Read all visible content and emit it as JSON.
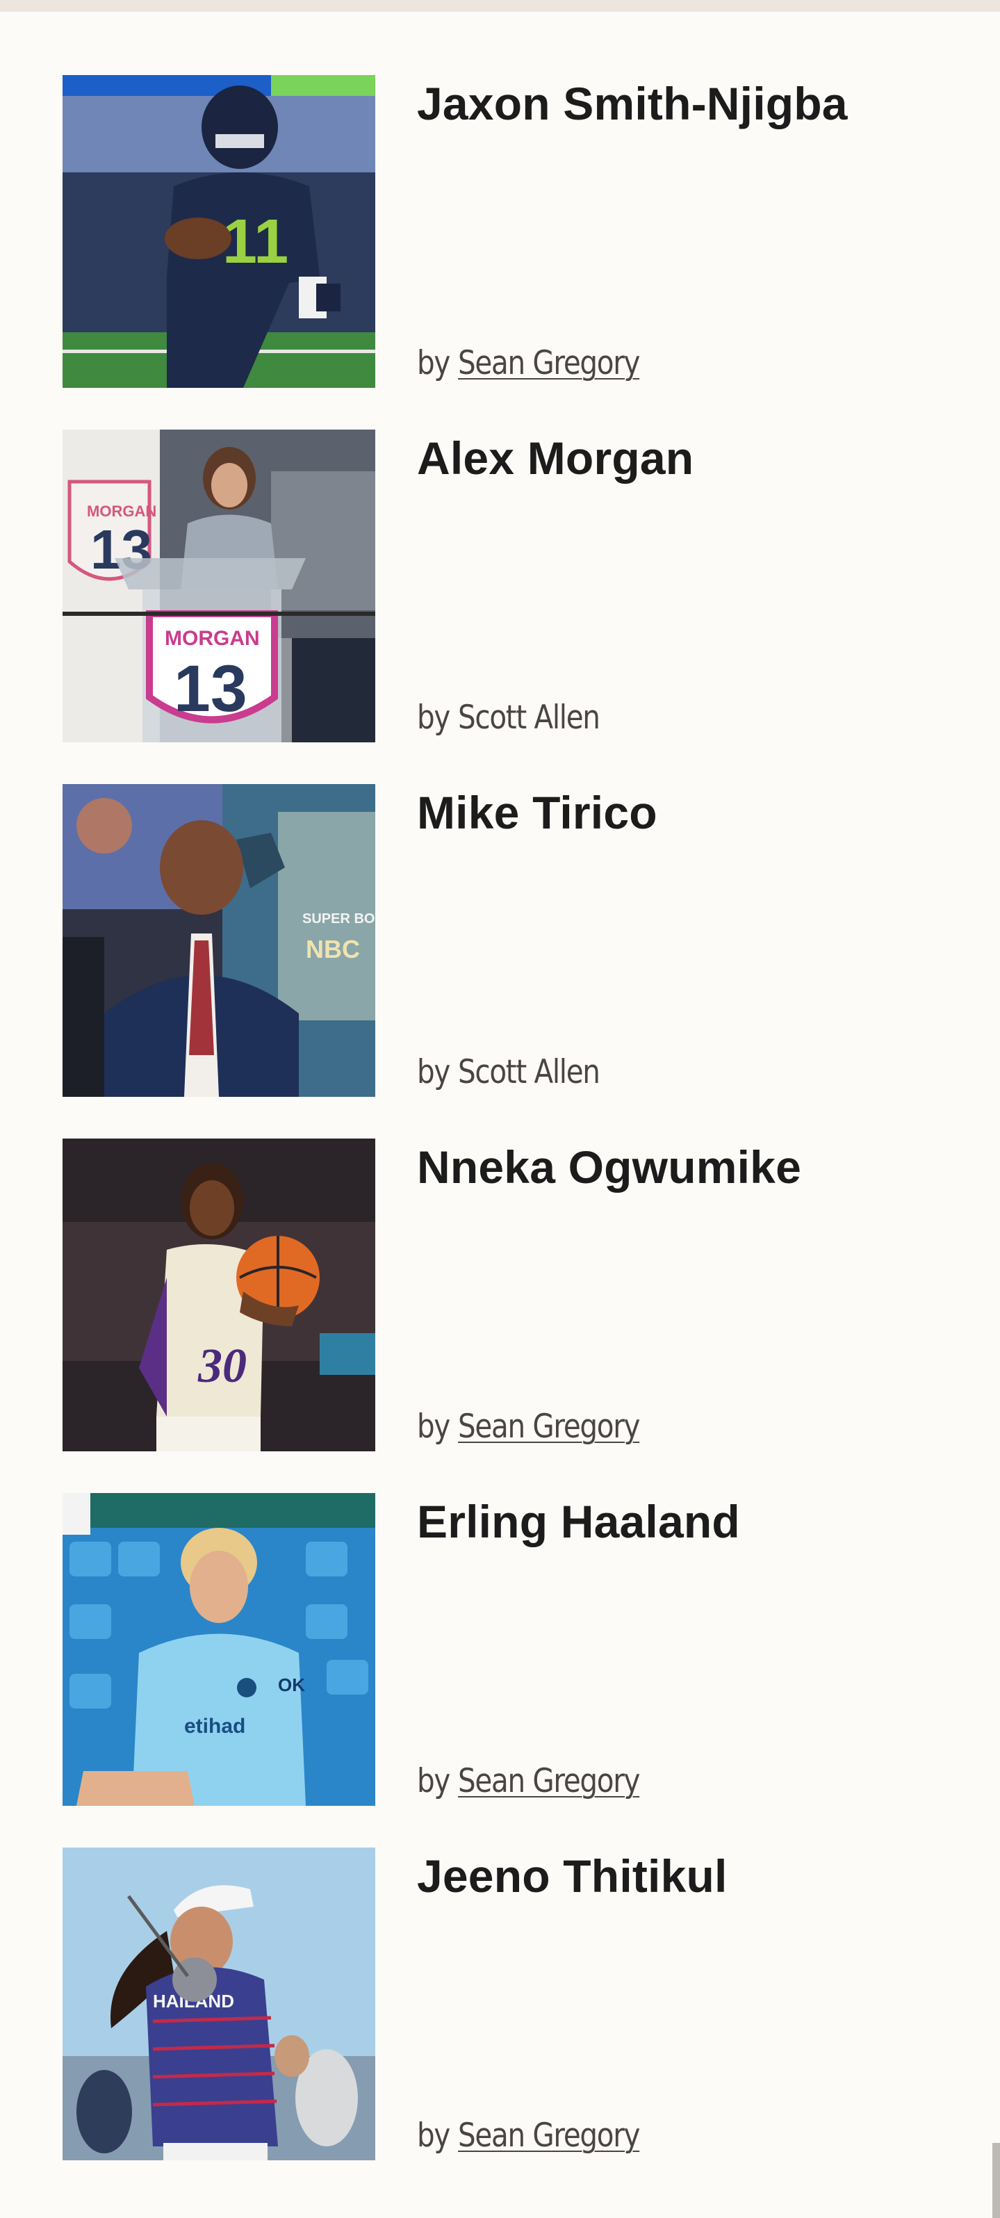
{
  "articles": [
    {
      "name": "Jaxon Smith-Njigba",
      "by": "by",
      "author": "Sean Gregory",
      "author_linked": true,
      "image_alt": "Seattle football player in navy jersey number 11 running with ball"
    },
    {
      "name": "Alex Morgan",
      "by": "by",
      "author": "Scott Allen",
      "author_linked": false,
      "image_alt": "Woman speaking at podium with MORGAN 13 shield"
    },
    {
      "name": "Mike Tirico",
      "by": "by",
      "author": "Scott Allen",
      "author_linked": false,
      "image_alt": "Broadcaster in navy suit and red tie on Super Bowl set"
    },
    {
      "name": "Nneka Ogwumike",
      "by": "by",
      "author": "Sean Gregory",
      "author_linked": true,
      "image_alt": "Basketball player in Sparks jersey number 30 holding basketball"
    },
    {
      "name": "Erling Haaland",
      "by": "by",
      "author": "Sean Gregory",
      "author_linked": true,
      "image_alt": "Soccer player in light blue Manchester City jersey seated in stadium"
    },
    {
      "name": "Jeeno Thitikul",
      "by": "by",
      "author": "Sean Gregory",
      "author_linked": true,
      "image_alt": "Golfer in Thailand shirt mid swing"
    }
  ],
  "colors": {
    "background": "#fdfbf7",
    "title": "#1c1c1c",
    "byline": "#4a4543"
  }
}
